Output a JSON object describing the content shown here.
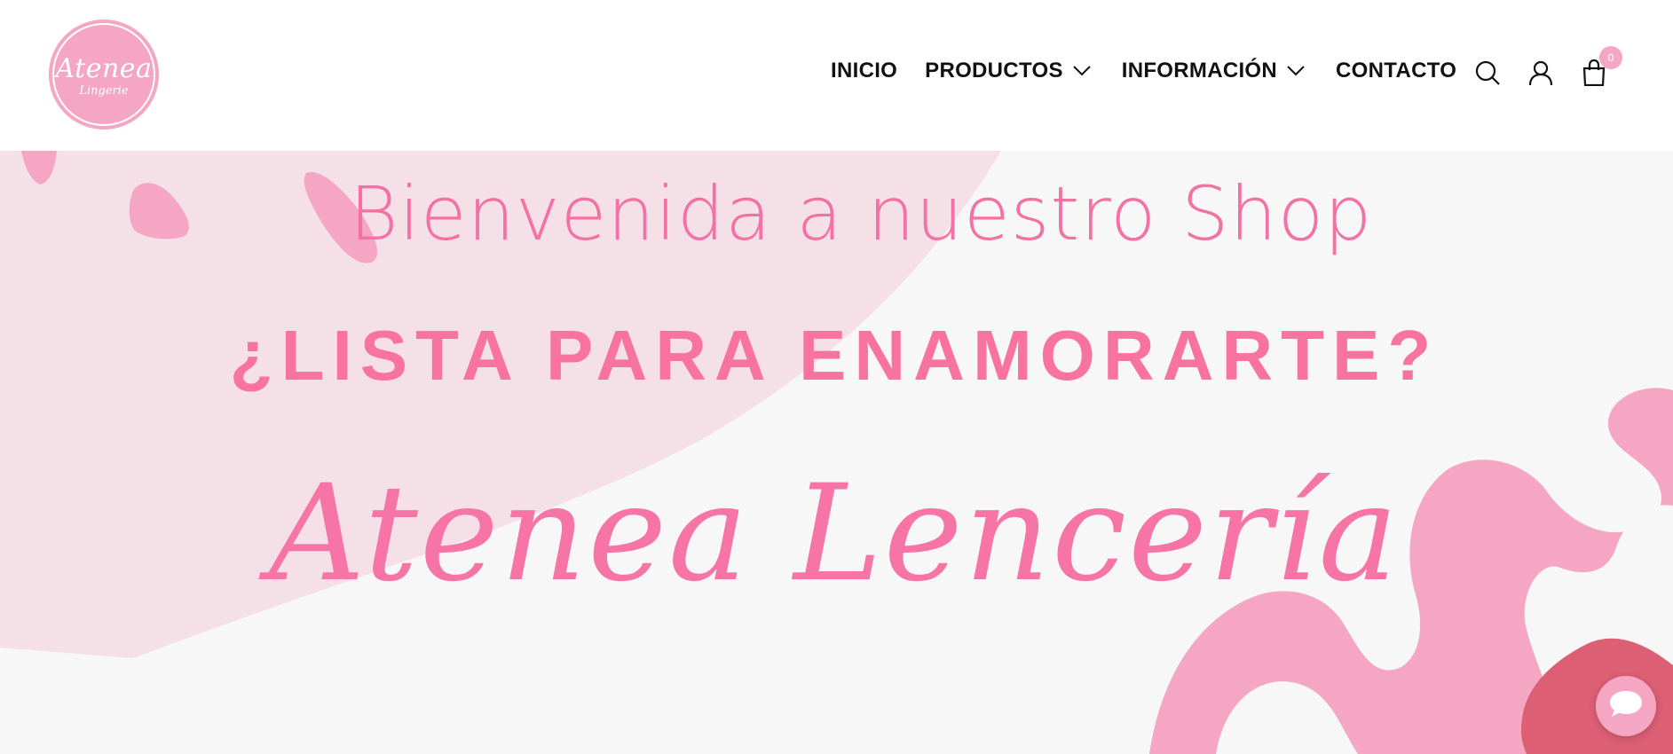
{
  "brand": {
    "logo_name": "Atenea",
    "logo_sub": "Lingerie"
  },
  "nav": {
    "items": [
      {
        "label": "INICIO",
        "has_dropdown": false
      },
      {
        "label": "PRODUCTOS",
        "has_dropdown": true
      },
      {
        "label": "INFORMACIÓN",
        "has_dropdown": true
      },
      {
        "label": "CONTACTO",
        "has_dropdown": false
      }
    ]
  },
  "header_icons": {
    "search": "search-icon",
    "account": "user-icon",
    "cart": "shopping-bag-icon",
    "cart_count": "0"
  },
  "hero": {
    "line1": "Bienvenida a nuestro Shop",
    "line2": "¿LISTA PARA ENAMORARTE?",
    "line3": "Atenea Lencería"
  },
  "chat": {
    "icon": "chat-bubble-icon"
  },
  "colors": {
    "accent_pink": "#f4a6c3",
    "text_pink": "#f372a3",
    "dark_pink": "#dc5f74",
    "light_pink_bg": "#f6e0e8",
    "hero_bg": "#f7f7f7"
  }
}
